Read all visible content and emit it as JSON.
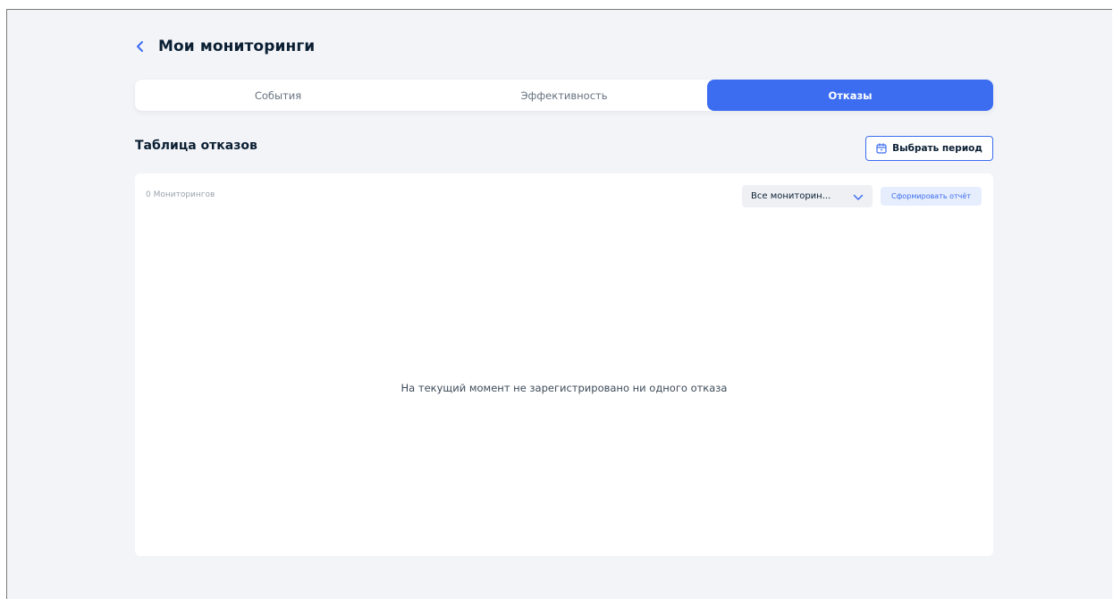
{
  "header": {
    "title": "Мои мониторинги"
  },
  "tabs": [
    {
      "label": "События",
      "active": false
    },
    {
      "label": "Эффективность",
      "active": false
    },
    {
      "label": "Отказы",
      "active": true
    }
  ],
  "section": {
    "title": "Таблица отказов",
    "period_button_label": "Выбрать период"
  },
  "card": {
    "count_label": "0 Мониторингов",
    "select_value": "Все мониторин...",
    "report_button_label": "Сформировать отчёт",
    "empty_message": "На текущий момент не зарегистрировано ни одного отказа"
  },
  "icons": {
    "back": "chevron-left-icon",
    "calendar": "calendar-icon",
    "dropdown": "chevron-down-icon"
  },
  "colors": {
    "accent": "#3c6df0",
    "page_background": "#f3f4f8",
    "title_text": "#0b1f33"
  }
}
